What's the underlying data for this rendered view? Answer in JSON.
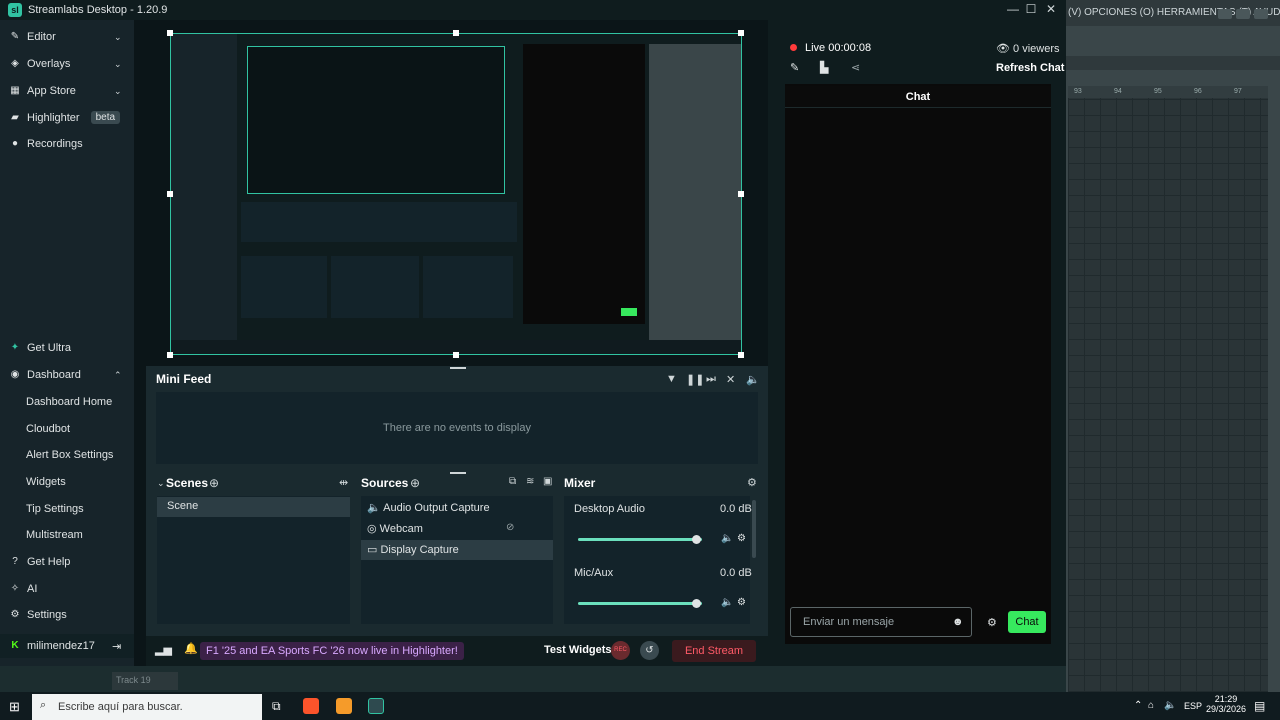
{
  "window": {
    "title": "Streamlabs Desktop - 1.20.9",
    "logo": "sl"
  },
  "daw": {
    "menu_text": "(V) OPCIONES (O) HERRAMIENTAS (T) AYUDA",
    "ruler": [
      "93",
      "94",
      "95",
      "96",
      "97"
    ],
    "track_label": "Track 19"
  },
  "sidebar": {
    "top": [
      {
        "icon": "pencil-icon",
        "label": "Editor"
      },
      {
        "icon": "overlays-icon",
        "label": "Overlays"
      },
      {
        "icon": "store-icon",
        "label": "App Store"
      },
      {
        "icon": "highlighter-icon",
        "label": "Highlighter",
        "badge": "beta"
      },
      {
        "icon": "recordings-icon",
        "label": "Recordings"
      }
    ],
    "bottom": {
      "get_ultra": "Get Ultra",
      "dashboard": "Dashboard",
      "dashboard_items": [
        "Dashboard Home",
        "Cloudbot",
        "Alert Box Settings",
        "Widgets",
        "Tip Settings",
        "Multistream"
      ],
      "get_help": "Get Help",
      "ai": "AI",
      "settings": "Settings",
      "user": "milimendez17"
    }
  },
  "mini_feed": {
    "title": "Mini Feed",
    "empty": "There are no events to display"
  },
  "scenes": {
    "title": "Scenes",
    "items": [
      "Scene"
    ]
  },
  "sources": {
    "title": "Sources",
    "items": [
      "Audio Output Capture",
      "Webcam",
      "Display Capture"
    ]
  },
  "mixer": {
    "title": "Mixer",
    "channels": [
      {
        "name": "Desktop Audio",
        "level": "0.0 dB",
        "fill": 0.95
      },
      {
        "name": "Mic/Aux",
        "level": "0.0 dB",
        "fill": 0.95
      }
    ]
  },
  "bottombar": {
    "news": "F1 '25 and EA Sports FC '26 now live in Highlighter!",
    "test_widgets": "Test Widgets",
    "rec": "REC",
    "end_stream": "End Stream"
  },
  "chat": {
    "live": "Live",
    "timer": "00:00:08",
    "viewers": "0 viewers",
    "refresh": "Refresh Chat",
    "title": "Chat",
    "placeholder": "Enviar un mensaje",
    "send": "Chat"
  },
  "taskbar": {
    "search_placeholder": "Escribe aquí para buscar.",
    "lang": "ESP",
    "time": "21:29",
    "date": "29/3/2026"
  },
  "colors": {
    "accent": "#31c3a2",
    "live": "#ff3b3b",
    "chat_btn": "#37e95e",
    "end_stream": "#ff5a67"
  }
}
